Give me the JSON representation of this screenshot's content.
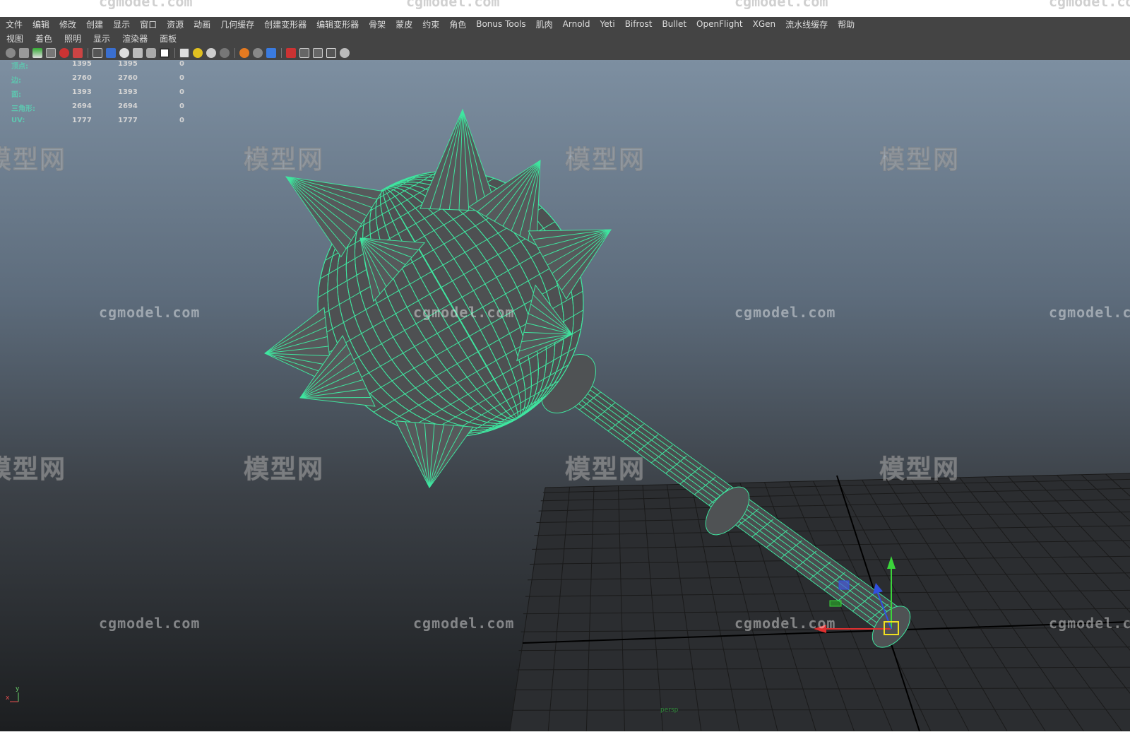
{
  "menubar": {
    "items": [
      "文件",
      "编辑",
      "修改",
      "创建",
      "显示",
      "窗口",
      "资源",
      "动画",
      "几何缓存",
      "创建变形器",
      "编辑变形器",
      "骨架",
      "蒙皮",
      "约束",
      "角色",
      "Bonus Tools",
      "肌肉",
      "Arnold",
      "Yeti",
      "Bifrost",
      "Bullet",
      "OpenFlight",
      "XGen",
      "流水线缓存",
      "帮助"
    ]
  },
  "panel_menu": {
    "items": [
      "视图",
      "着色",
      "照明",
      "显示",
      "渲染器",
      "面板"
    ]
  },
  "toolbar": {
    "icons": [
      "camera-attributes-icon",
      "bookmark-icon",
      "image-plane-icon",
      "grid-icon",
      "film-gate-icon",
      "resolution-gate-icon",
      "wireframe-icon",
      "smooth-shade-icon",
      "wireframe-on-shaded-icon",
      "textured-icon",
      "use-all-lights-icon",
      "shadows-icon",
      "isolate-select-icon",
      "xray-icon",
      "xray-joints-icon",
      "backface-culling-icon",
      "ambient-occlusion-icon",
      "motion-blur-icon",
      "anti-aliasing-icon",
      "depth-of-field-icon",
      "select-camera-icon",
      "frame-all-icon",
      "frame-selection-icon",
      "pipeline-icon"
    ]
  },
  "hud": {
    "rows": [
      {
        "label": "顶点:",
        "v1": "1395",
        "v2": "1395",
        "v3": "0"
      },
      {
        "label": "边:",
        "v1": "2760",
        "v2": "2760",
        "v3": "0"
      },
      {
        "label": "面:",
        "v1": "1393",
        "v2": "1393",
        "v3": "0"
      },
      {
        "label": "三角形:",
        "v1": "2694",
        "v2": "2694",
        "v3": "0"
      },
      {
        "label": "UV:",
        "v1": "1777",
        "v2": "1777",
        "v3": "0"
      }
    ]
  },
  "watermark": {
    "logo_text": "模型网",
    "url_text": "cgmodel.com"
  },
  "viewport": {
    "camera_label": "persp",
    "axis_x": "x",
    "axis_y": "y"
  },
  "colors": {
    "wire": "#3fe6a0",
    "ui_bg": "#444444",
    "menu_text": "#dddddd"
  }
}
